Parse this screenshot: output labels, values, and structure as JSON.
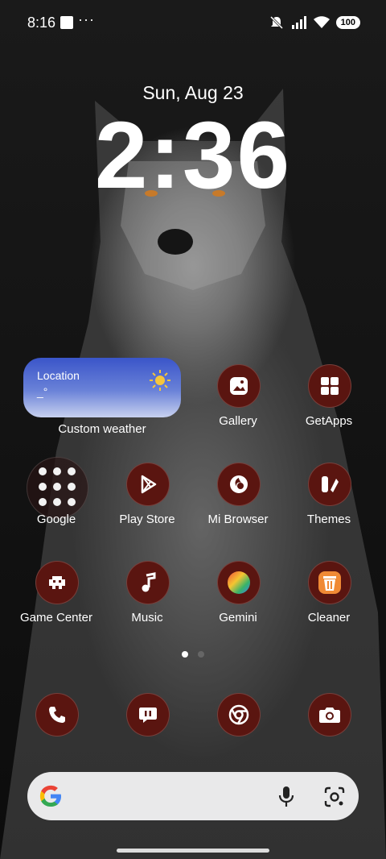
{
  "status_bar": {
    "time": "8:16",
    "more": "···",
    "battery": "100"
  },
  "lockclock": {
    "date": "Sun, Aug 23",
    "time": "2:36"
  },
  "weather": {
    "location": "Location",
    "temp": "_°",
    "label": "Custom weather"
  },
  "apps": {
    "gallery": "Gallery",
    "getapps": "GetApps",
    "google": "Google",
    "playstore": "Play Store",
    "mibrowser": "Mi Browser",
    "themes": "Themes",
    "gamecenter": "Game Center",
    "music": "Music",
    "gemini": "Gemini",
    "cleaner": "Cleaner"
  },
  "icons": {
    "dock": [
      "phone-icon",
      "messages-icon",
      "chrome-icon",
      "camera-icon"
    ],
    "search": [
      "google-g-icon",
      "mic-icon",
      "lens-icon"
    ]
  },
  "colors": {
    "icon_bg": "#5a1510",
    "search_bg": "#e9e9ea",
    "weather_top": "#3a55c9"
  },
  "pager": {
    "active_page": 1,
    "pages": 2
  }
}
